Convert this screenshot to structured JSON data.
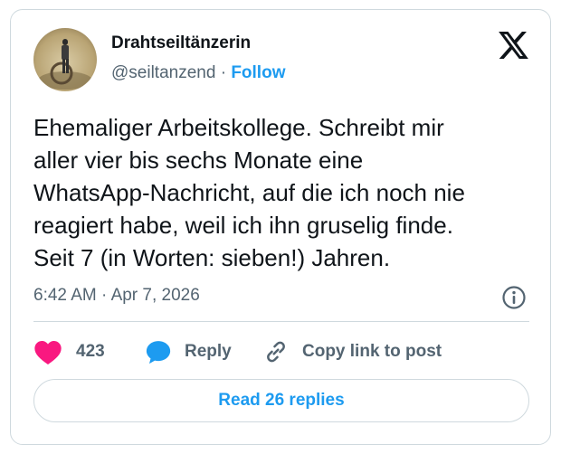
{
  "author": {
    "display_name": "Drahtseiltänzerin",
    "handle": "@seiltanzend",
    "separator": "·",
    "follow_label": "Follow"
  },
  "post": {
    "text_lines": [
      "Ehemaliger Arbeitskollege. Schreibt mir",
      "aller vier bis sechs Monate eine",
      "WhatsApp-Nachricht, auf die ich noch nie",
      "reagiert habe, weil ich ihn gruselig finde.",
      "Seit 7 (in Worten: sieben!) Jahren."
    ],
    "time": "6:42 AM",
    "date_separator": "·",
    "date": "Apr 7, 2026"
  },
  "actions": {
    "like_count": "423",
    "reply_label": "Reply",
    "copy_label": "Copy link to post"
  },
  "read_replies_label": "Read 26 replies",
  "icons": {
    "logo": "x-logo-icon",
    "info": "info-icon",
    "like": "heart-icon",
    "reply": "speech-bubble-icon",
    "copy": "link-icon"
  },
  "colors": {
    "accent": "#1d9bf0",
    "like": "#f91880",
    "muted": "#536471",
    "text": "#0f1419",
    "border": "#cfd9de"
  }
}
